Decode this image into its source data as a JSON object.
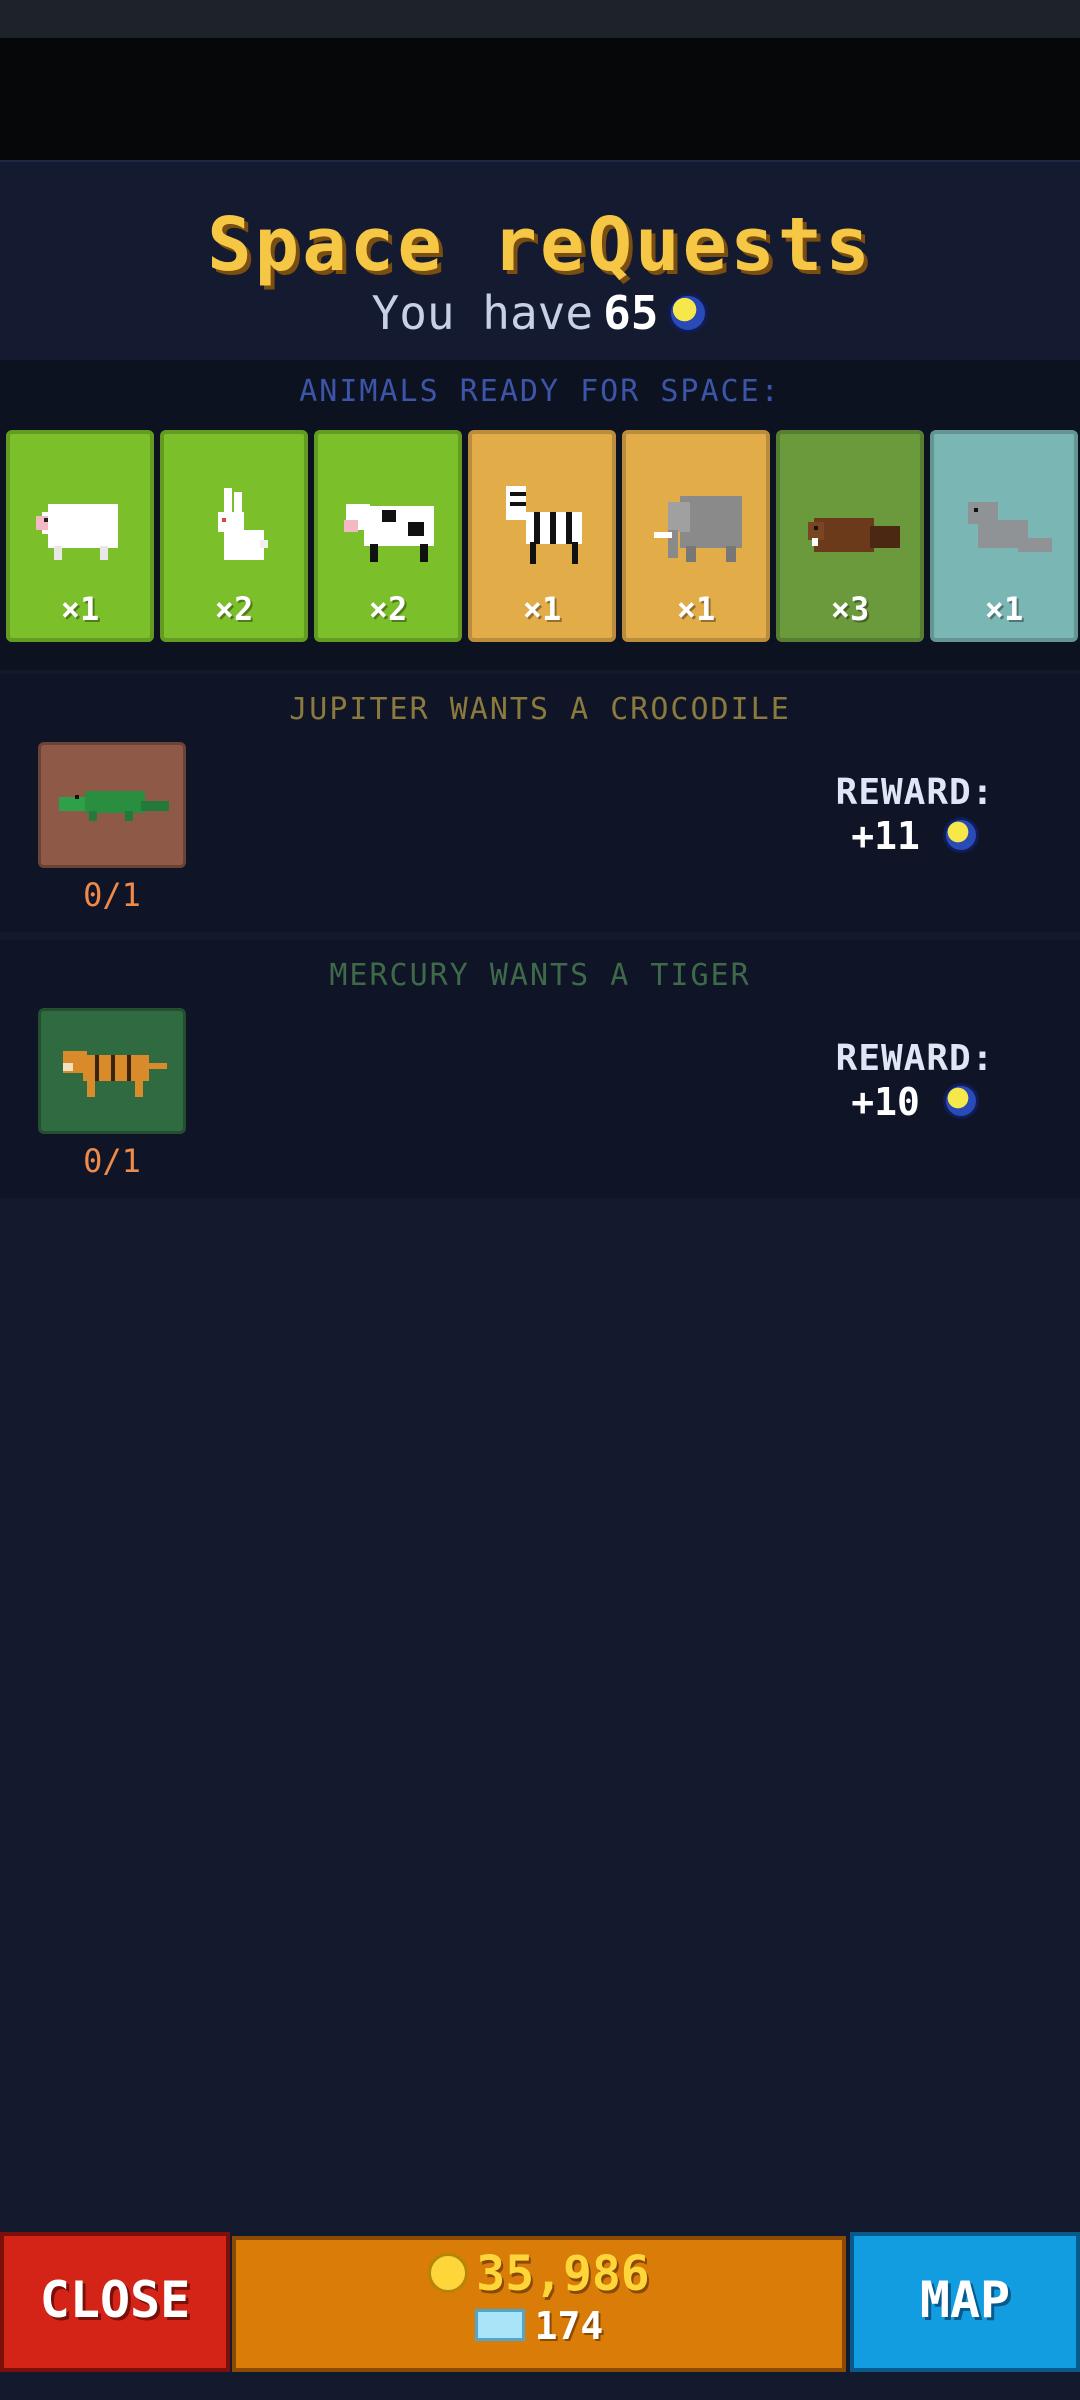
{
  "header": {
    "title": "Space reQuests",
    "you_have_prefix": "You have",
    "you_have_amount": "65",
    "currency_icon": "space-coin-icon"
  },
  "ready": {
    "label": "ANIMALS READY FOR SPACE:",
    "animals": [
      {
        "name": "sheep",
        "count": "×1",
        "tier": "green"
      },
      {
        "name": "rabbit",
        "count": "×2",
        "tier": "green"
      },
      {
        "name": "cow",
        "count": "×2",
        "tier": "green"
      },
      {
        "name": "zebra",
        "count": "×1",
        "tier": "gold"
      },
      {
        "name": "elephant",
        "count": "×1",
        "tier": "gold"
      },
      {
        "name": "beaver",
        "count": "×3",
        "tier": "moss"
      },
      {
        "name": "seal",
        "count": "×1",
        "tier": "teal"
      }
    ]
  },
  "quests": [
    {
      "title": "JUPITER WANTS A CROCODILE",
      "animal": "crocodile",
      "progress": "0/1",
      "reward_label": "REWARD:",
      "reward_value": "+11"
    },
    {
      "title": "MERCURY WANTS A TIGER",
      "animal": "tiger",
      "progress": "0/1",
      "reward_label": "REWARD:",
      "reward_value": "+10"
    }
  ],
  "footer": {
    "close_label": "CLOSE",
    "gold_amount": "35,986",
    "tickets_amount": "174",
    "map_label": "MAP"
  },
  "colors": {
    "title": "#f6c744",
    "background": "#131a2e",
    "close": "#d42418",
    "money": "#d97c08",
    "map": "#129de0"
  }
}
